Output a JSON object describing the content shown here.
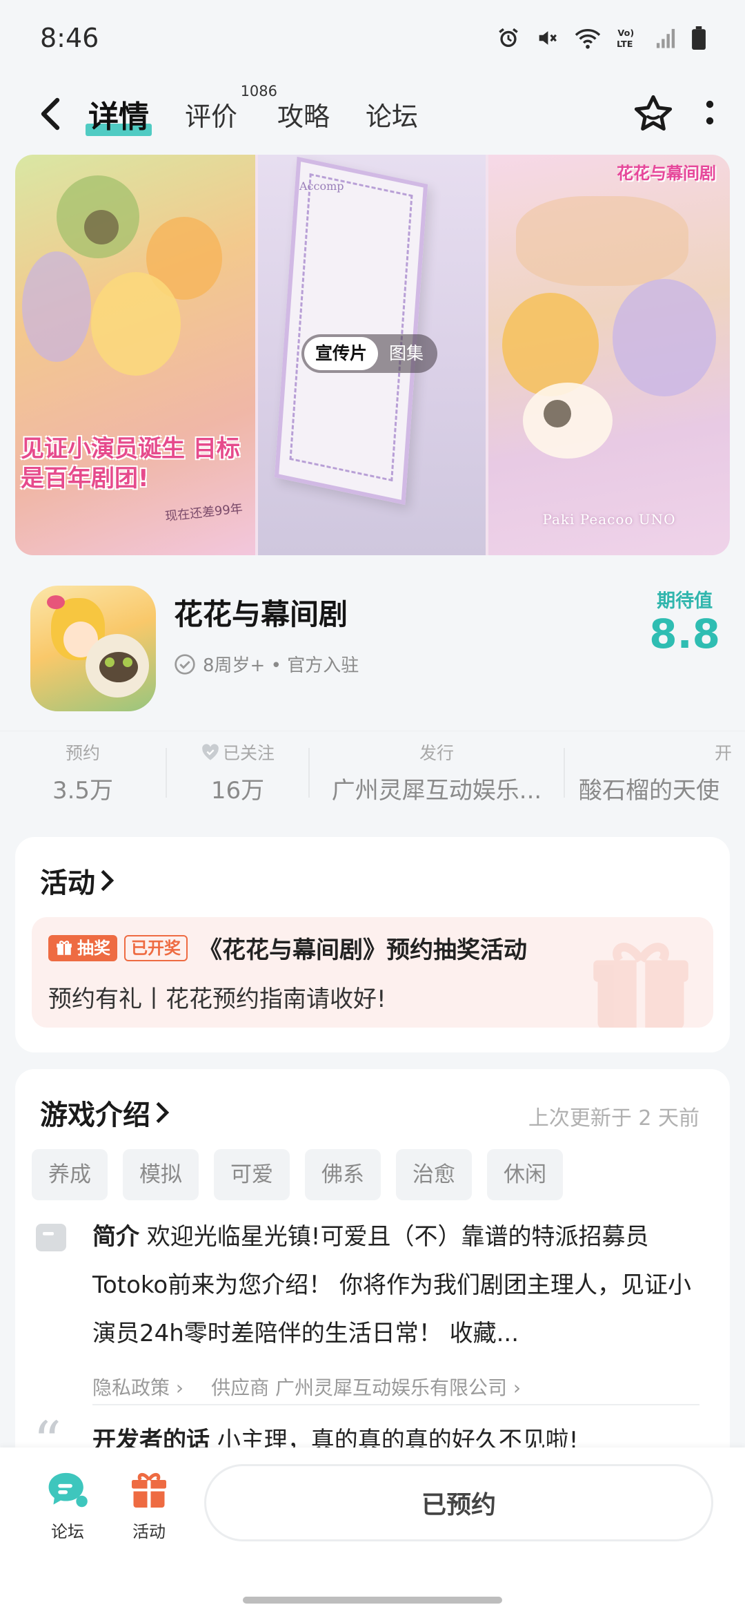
{
  "status_bar": {
    "time": "8:46"
  },
  "header": {
    "tabs": [
      {
        "label": "详情",
        "active": true
      },
      {
        "label": "评价",
        "count": "1086"
      },
      {
        "label": "攻略"
      },
      {
        "label": "论坛"
      }
    ]
  },
  "banner": {
    "slogan": "见证小演员诞生 目标是百年剧团!",
    "handwritten_note": "现在还差99年",
    "logo_text": "花花与幕间剧",
    "paper_text": "Accomp",
    "credits": "Paki  Peacoo  UNO",
    "segments": [
      {
        "label": "宣传片",
        "active": true
      },
      {
        "label": "图集",
        "active": false
      }
    ]
  },
  "app": {
    "name": "花花与幕间剧",
    "tags": "8周岁+ • 官方入驻",
    "score_label": "期待值",
    "score": "8.8"
  },
  "stats": [
    {
      "label": "预约",
      "value": "3.5万"
    },
    {
      "label": "已关注",
      "value": "16万"
    },
    {
      "label": "发行",
      "value": "广州灵犀互动娱乐..."
    },
    {
      "label": "开",
      "value": "酸石榴的天使"
    }
  ],
  "activity": {
    "title": "活动",
    "badge_lottery": "抽奖",
    "badge_open": "已开奖",
    "item_title": "《花花与幕间剧》预约抽奖活动",
    "item_subtitle": "预约有礼丨花花预约指南请收好!"
  },
  "intro": {
    "title": "游戏介绍",
    "updated": "上次更新于 2 天前",
    "tags": [
      "养成",
      "模拟",
      "可爱",
      "佛系",
      "治愈",
      "休闲"
    ],
    "brief_label": "简介",
    "brief_text": "欢迎光临星光镇!可爱且（不）靠谱的特派招募员Totoko前来为您介绍！ 你将作为我们剧团主理人，见证小演员24h零时差陪伴的生活日常！ 收藏...",
    "privacy_link": "隐私政策",
    "supplier_link": "供应商 广州灵犀互动娱乐有限公司",
    "dev_label": "开发者的话",
    "dev_text": "小主理，真的真的真的好久不见啦!"
  },
  "bottom_bar": {
    "forum_label": "论坛",
    "activity_label": "活动",
    "reserve_label": "已预约"
  },
  "colors": {
    "accent_teal": "#2fbdb2",
    "accent_orange": "#ee6b42"
  }
}
